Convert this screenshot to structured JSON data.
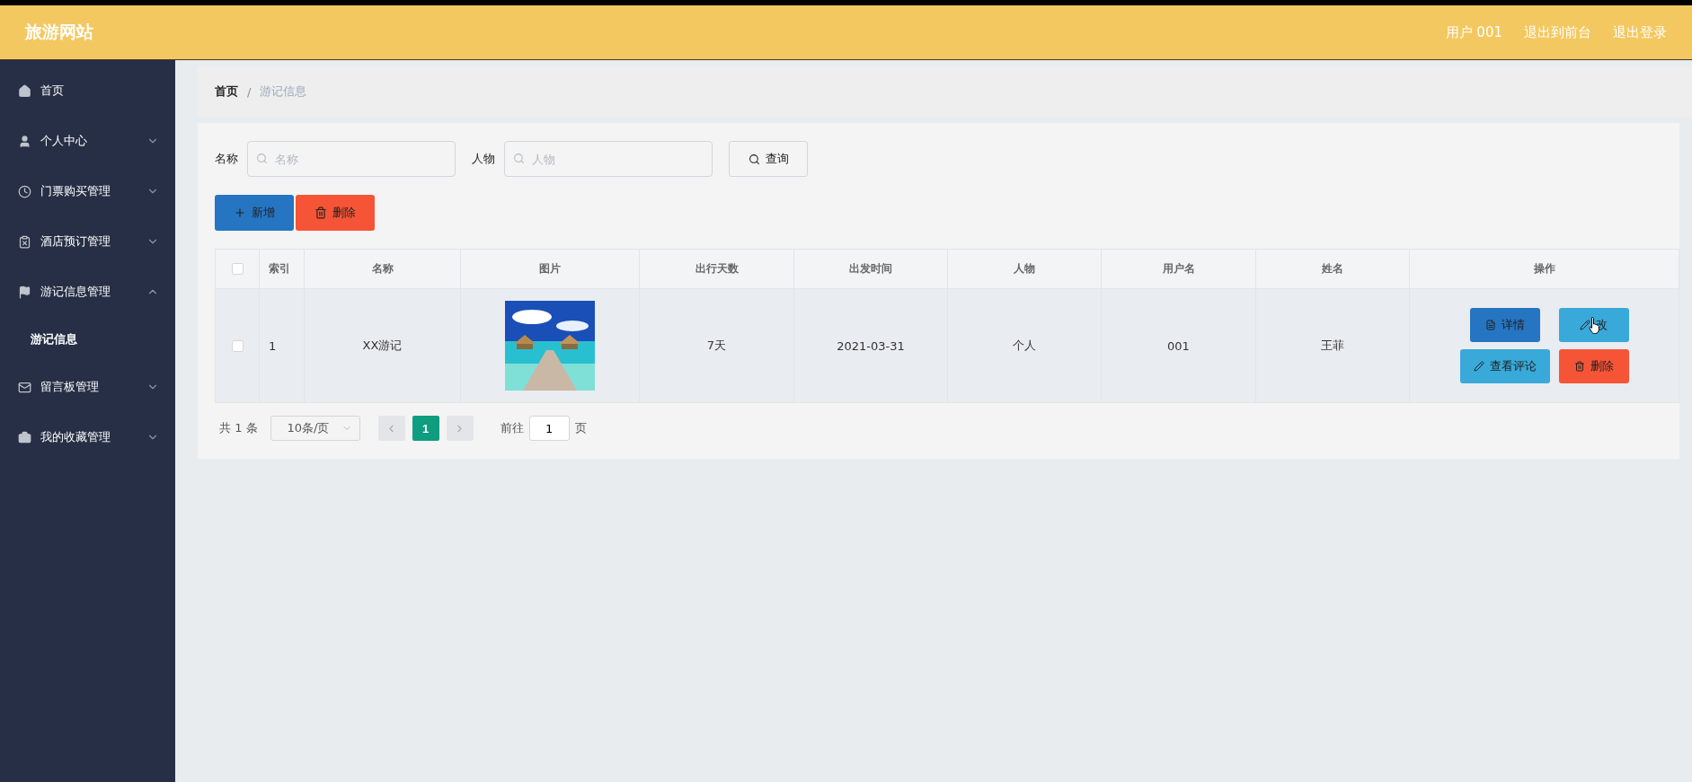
{
  "header": {
    "title": "旅游网站",
    "links": [
      "用户 001",
      "退出到前台",
      "退出登录"
    ]
  },
  "sidebar": {
    "items": [
      {
        "label": "首页"
      },
      {
        "label": "个人中心",
        "expanded": false
      },
      {
        "label": "门票购买管理",
        "expanded": false
      },
      {
        "label": "酒店预订管理",
        "expanded": false
      },
      {
        "label": "游记信息管理",
        "expanded": true,
        "children": [
          {
            "label": "游记信息",
            "selected": true
          }
        ]
      },
      {
        "label": "留言板管理",
        "expanded": false
      },
      {
        "label": "我的收藏管理",
        "expanded": false
      }
    ]
  },
  "breadcrumb": [
    "首页",
    "游记信息"
  ],
  "breadcrumb_separator": "/",
  "search": {
    "fields": [
      {
        "label": "名称",
        "placeholder": "名称"
      },
      {
        "label": "人物",
        "placeholder": "人物"
      }
    ],
    "button": "查询"
  },
  "toolbar": [
    {
      "label": "新增",
      "kind": "add"
    },
    {
      "label": "删除",
      "kind": "delete"
    }
  ],
  "table": {
    "all_checked": false,
    "columns": [
      "索引",
      "名称",
      "图片",
      "出行天数",
      "出发时间",
      "人物",
      "用户名",
      "姓名",
      "操作"
    ],
    "rows": [
      {
        "checked": false,
        "index": "1",
        "name": "XX游记",
        "days": "7天",
        "date": "2021-03-31",
        "person": "个人",
        "username": "001",
        "realname": "王菲",
        "actions": [
          {
            "label": "详情",
            "kind": "detail"
          },
          {
            "label": "改",
            "kind": "edit",
            "hovered": true
          },
          {
            "label": "查看评论",
            "kind": "comments"
          },
          {
            "label": "删除",
            "kind": "delete"
          }
        ]
      }
    ]
  },
  "pagination": {
    "total": "共 1 条",
    "page_size": "10条/页",
    "pages": [
      {
        "label": "1",
        "selected": true
      }
    ],
    "goto": "前往",
    "goto_value": "1",
    "page_unit": "页"
  }
}
